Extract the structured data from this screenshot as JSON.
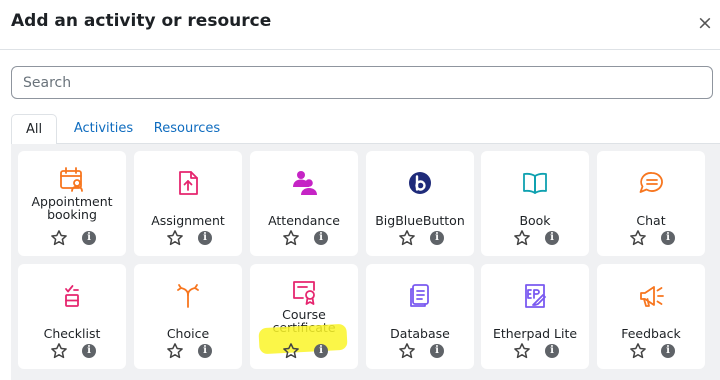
{
  "dialog": {
    "title": "Add an activity or resource",
    "close_symbol": "×"
  },
  "search": {
    "placeholder": "Search",
    "value": ""
  },
  "tabs": [
    {
      "label": "All",
      "active": true
    },
    {
      "label": "Activities",
      "active": false
    },
    {
      "label": "Resources",
      "active": false
    }
  ],
  "activities": [
    {
      "label": "Appointment booking",
      "icon": "appointment-calendar-icon",
      "color": "#f7761f"
    },
    {
      "label": "Assignment",
      "icon": "assignment-upload-icon",
      "color": "#e6266f"
    },
    {
      "label": "Attendance",
      "icon": "attendance-people-icon",
      "color": "#c524c5"
    },
    {
      "label": "BigBlueButton",
      "icon": "bigbluebutton-icon",
      "color": "#1f2b7a"
    },
    {
      "label": "Book",
      "icon": "book-icon",
      "color": "#0fa1b0"
    },
    {
      "label": "Chat",
      "icon": "chat-icon",
      "color": "#f7761f"
    },
    {
      "label": "Checklist",
      "icon": "checklist-icon",
      "color": "#e6266f"
    },
    {
      "label": "Choice",
      "icon": "choice-icon",
      "color": "#f7761f"
    },
    {
      "label": "Course certificate",
      "icon": "certificate-icon",
      "color": "#e6266f"
    },
    {
      "label": "Database",
      "icon": "database-icon",
      "color": "#7a5af0"
    },
    {
      "label": "Etherpad Lite",
      "icon": "etherpad-icon",
      "color": "#7a5af0"
    },
    {
      "label": "Feedback",
      "icon": "feedback-megaphone-icon",
      "color": "#f7761f"
    }
  ],
  "colors": {
    "link": "#0f6cbf",
    "panel_bg": "#f0f1f3",
    "highlight": "#faf428"
  }
}
